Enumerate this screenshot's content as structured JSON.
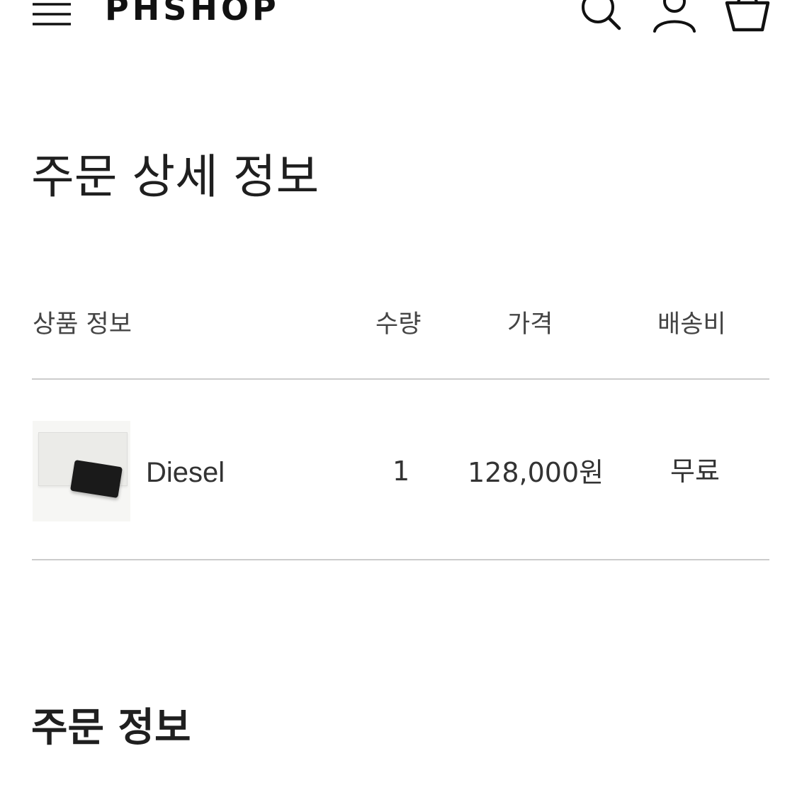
{
  "header": {
    "brand": "PHSHOP",
    "icons": {
      "menu": "hamburger-menu-icon",
      "search": "search-icon",
      "account": "user-icon",
      "cart": "shopping-bag-icon"
    }
  },
  "page": {
    "title": "주문 상세 정보"
  },
  "order_table": {
    "columns": [
      "상품 정보",
      "수량",
      "가격",
      "배송비"
    ],
    "rows": [
      {
        "thumbnail": "product-thumbnail",
        "name": "Diesel",
        "quantity": "1",
        "price": "128,000원",
        "shipping": "무료"
      }
    ]
  },
  "order_info": {
    "title": "주문 정보"
  },
  "colors": {
    "text": "#222222",
    "divider": "#cccccc",
    "background": "#ffffff"
  }
}
